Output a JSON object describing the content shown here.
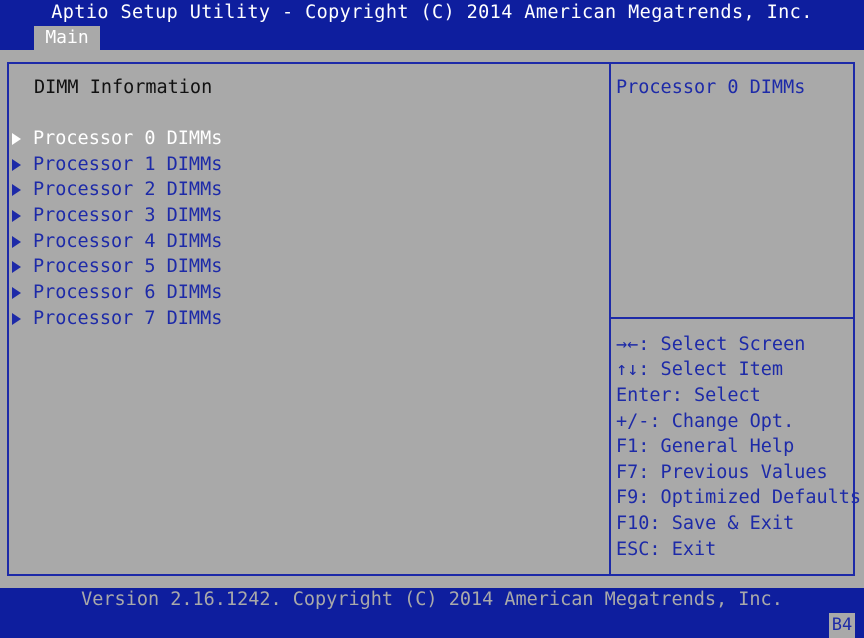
{
  "header": {
    "title": "Aptio Setup Utility - Copyright (C) 2014 American Megatrends, Inc."
  },
  "tabs": [
    {
      "label": "Main"
    }
  ],
  "main": {
    "section_title": "DIMM Information",
    "items": [
      {
        "label": "Processor 0 DIMMs"
      },
      {
        "label": "Processor 1 DIMMs"
      },
      {
        "label": "Processor 2 DIMMs"
      },
      {
        "label": "Processor 3 DIMMs"
      },
      {
        "label": "Processor 4 DIMMs"
      },
      {
        "label": "Processor 5 DIMMs"
      },
      {
        "label": "Processor 6 DIMMs"
      },
      {
        "label": "Processor 7 DIMMs"
      }
    ],
    "selected_index": 0
  },
  "help": {
    "description": "Processor 0 DIMMs",
    "keys": [
      "→←: Select Screen",
      "↑↓: Select Item",
      "Enter: Select",
      "+/-: Change Opt.",
      "F1: General Help",
      "F7: Previous Values",
      "F9: Optimized Defaults",
      "F10: Save & Exit",
      "ESC: Exit"
    ]
  },
  "footer": {
    "version": "Version 2.16.1242. Copyright (C) 2014 American Megatrends, Inc.",
    "badge": "B4"
  },
  "colors": {
    "background_blue": "#0e1e9e",
    "panel_gray": "#a9a9a9",
    "text_blue": "#1d2aa8",
    "highlight_white": "#ffffff"
  }
}
